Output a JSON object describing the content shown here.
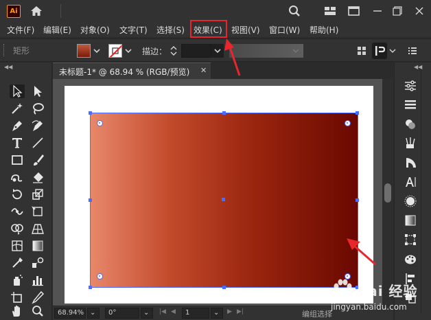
{
  "app": {
    "logo_text": "Ai",
    "menu": [
      "文件(F)",
      "编辑(E)",
      "对象(O)",
      "文字(T)",
      "选择(S)",
      "效果(C)",
      "视图(V)",
      "窗口(W)",
      "帮助(H)"
    ],
    "highlighted_menu": "效果(C)"
  },
  "control_bar": {
    "shape_label": "矩形",
    "stroke_label": "描边：",
    "stroke_value": ""
  },
  "document": {
    "tab_title": "未标题-1* @ 68.94 % (RGB/预览)",
    "close_glyph": "✕"
  },
  "status_bar": {
    "zoom": "68.94%",
    "angle": "0°",
    "page": "1",
    "status_text": "编组选择"
  },
  "artwork": {
    "shape": "rectangle",
    "gradient_colors": [
      "#e8876a",
      "#c24a2b",
      "#9b260f",
      "#6a0800"
    ],
    "selection_color": "#4a6cff"
  },
  "annotations": {
    "highlight_color": "#e8262c"
  },
  "watermark": {
    "brand": "Bai 经验",
    "url": "jingyan.baidu.com"
  },
  "left_tools": [
    "selection-tool",
    "direct-selection-tool",
    "magic-wand-tool",
    "lasso-tool",
    "pen-tool",
    "curvature-tool",
    "type-tool",
    "line-segment-tool",
    "rectangle-tool",
    "paintbrush-tool",
    "shaper-tool",
    "eraser-tool",
    "rotate-tool",
    "scale-tool",
    "width-tool",
    "free-transform-tool",
    "shape-builder-tool",
    "perspective-grid-tool",
    "mesh-tool",
    "gradient-tool",
    "eyedropper-tool",
    "blend-tool",
    "symbol-sprayer-tool",
    "column-graph-tool",
    "artboard-tool",
    "slice-tool",
    "hand-tool",
    "zoom-tool"
  ],
  "right_panels": [
    "properties-icon",
    "layers-icon",
    "color-icon",
    "swatches-icon",
    "brushes-icon",
    "symbols-icon",
    "stroke-icon",
    "character-icon",
    "appearance-icon",
    "gradient-icon",
    "transform-icon",
    "graphic-styles-icon",
    "align-icon"
  ]
}
